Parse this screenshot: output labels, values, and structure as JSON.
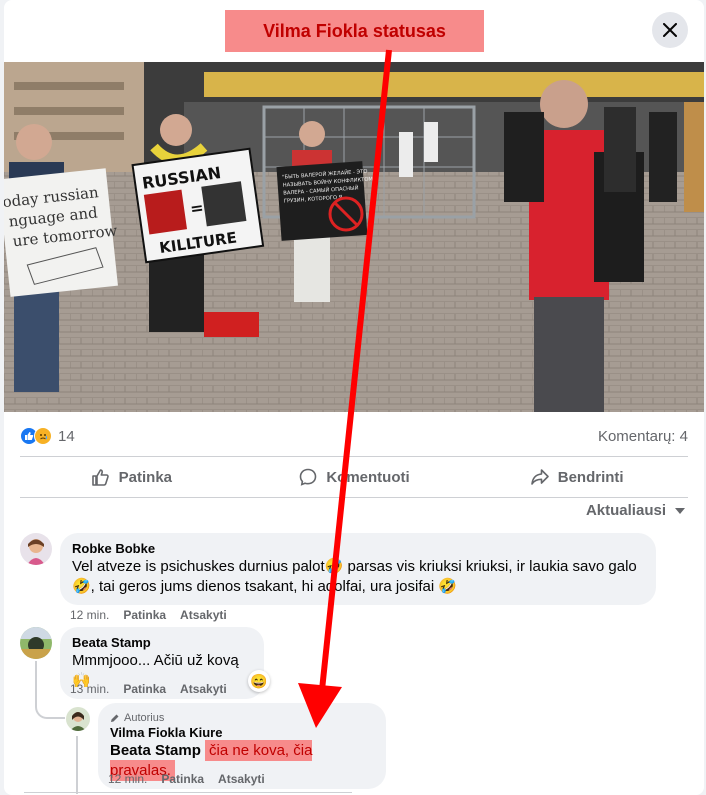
{
  "annotation": {
    "title_label": "Vilma Fiokla statusas"
  },
  "photo": {
    "signs": [
      {
        "lines": [
          "oday russian",
          "nguage and",
          "ure tomorrow"
        ]
      },
      {
        "top": "RUSSIAN",
        "bottom": "KILLTURE"
      },
      {
        "lines": [
          "\"БЫТЬ ВАЛЕРОЙ ЖЕЛАЙЕ - ЭТО",
          "НАЗЫВАТЬ ВОЙНУ КОНФЛИКТОМ\"",
          "ВАЛЕРА - САМЫЙ ОПАСНЫЙ",
          "ГРУЗИН, КОТОРОГО Я"
        ]
      }
    ]
  },
  "stats": {
    "reaction_count": "14",
    "comments_label": "Komentarų: 4"
  },
  "actions": {
    "like": "Patinka",
    "comment": "Komentuoti",
    "share": "Bendrinti"
  },
  "sort": {
    "label": "Aktualiausi"
  },
  "comments": [
    {
      "author": "Robke Bobke",
      "line1": "Vel atveze is psichuskes durnius palot🤣 parsas vis kriuksi kriuksi, ir laukia savo galo",
      "line2": "🤣, tai geros jums dienos tsakant, hi adolfai, ura josifai 🤣",
      "time": "12 min.",
      "like": "Patinka",
      "reply": "Atsakyti"
    },
    {
      "author": "Beata Stamp",
      "text": "Mmmjooo... Ačiū už kovą 🙌",
      "reaction_emoji": "😄",
      "time": "13 min.",
      "like": "Patinka",
      "reply": "Atsakyti"
    },
    {
      "badge": "Autorius",
      "author": "Vilma Fiokla Kiure",
      "tag": "Beata Stamp",
      "text": "čia ne kova, čia pravalas.",
      "time": "12 min.",
      "like": "Patinka",
      "reply": "Atsakyti"
    }
  ],
  "colors": {
    "accent": "#1877f2",
    "annotation_red": "#ff0000",
    "annotation_fill": "#f78b8b"
  }
}
